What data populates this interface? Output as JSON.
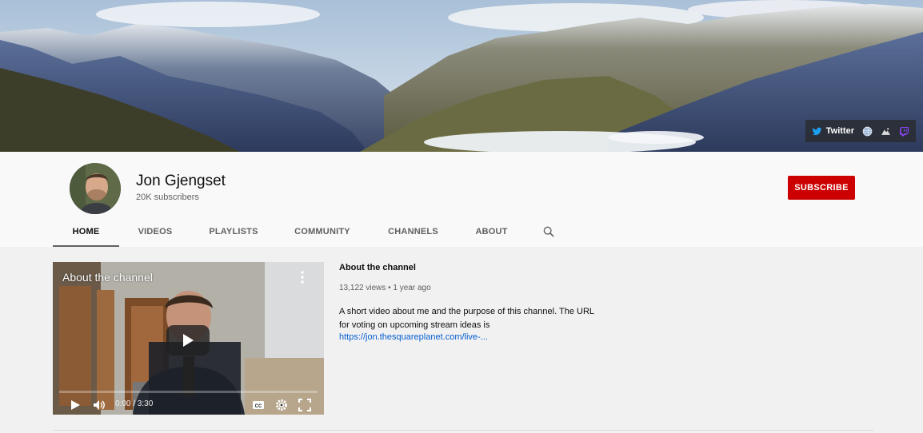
{
  "banner": {
    "links": [
      {
        "label": "Twitter",
        "icon": "twitter-icon"
      },
      {
        "label": "",
        "icon": "globe-icon"
      },
      {
        "label": "",
        "icon": "mountain-link-icon"
      },
      {
        "label": "",
        "icon": "twitch-icon"
      }
    ]
  },
  "channel": {
    "name": "Jon Gjengset",
    "subscribers": "20K subscribers",
    "subscribe_label": "SUBSCRIBE",
    "subscribe_color": "#cc0000"
  },
  "tabs": [
    {
      "label": "HOME",
      "active": true
    },
    {
      "label": "VIDEOS",
      "active": false
    },
    {
      "label": "PLAYLISTS",
      "active": false
    },
    {
      "label": "COMMUNITY",
      "active": false
    },
    {
      "label": "CHANNELS",
      "active": false
    },
    {
      "label": "ABOUT",
      "active": false
    }
  ],
  "video": {
    "overlay_title": "About the channel",
    "current_time": "0:00 / 3:30",
    "progress_fraction": 0.0
  },
  "info": {
    "title": "About the channel",
    "meta": "13,122 views • 1 year ago",
    "description": "A short video about me and the purpose of this channel. The URL for voting on upcoming stream ideas is",
    "link": "https://jon.thesquareplanet.com/live-..."
  }
}
